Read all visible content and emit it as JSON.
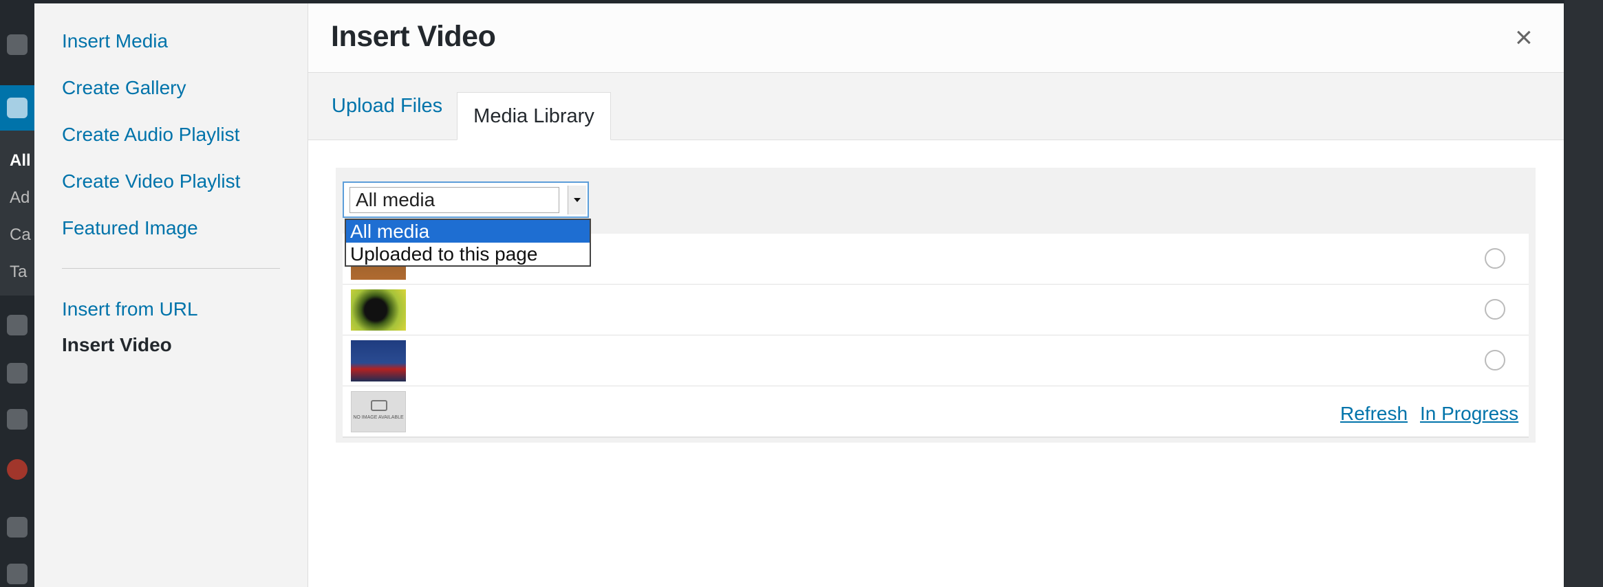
{
  "modal": {
    "title": "Insert Video",
    "close_label": "×"
  },
  "menu": {
    "items": [
      {
        "label": "Insert Media"
      },
      {
        "label": "Create Gallery"
      },
      {
        "label": "Create Audio Playlist"
      },
      {
        "label": "Create Video Playlist"
      },
      {
        "label": "Featured Image"
      }
    ],
    "secondary": [
      {
        "label": "Insert from URL"
      },
      {
        "label": "Insert Video"
      }
    ]
  },
  "tabs": [
    {
      "label": "Upload Files"
    },
    {
      "label": "Media Library"
    }
  ],
  "filter": {
    "selected": "All media",
    "options": [
      "All media",
      "Uploaded to this page"
    ]
  },
  "rows": [
    {
      "thumb": "video-thumbnail-1"
    },
    {
      "thumb": "video-thumbnail-2"
    },
    {
      "thumb": "video-thumbnail-3"
    },
    {
      "thumb": "no-image-available",
      "thumb_text": "NO IMAGE AVAILABLE",
      "refresh_label": "Refresh",
      "status_label": "In Progress"
    }
  ],
  "background": {
    "labels": [
      "All",
      "Ad",
      "Ca",
      "Ta"
    ]
  },
  "colors": {
    "accent": "#0073aa",
    "selected_option": "#1e6ed2"
  }
}
